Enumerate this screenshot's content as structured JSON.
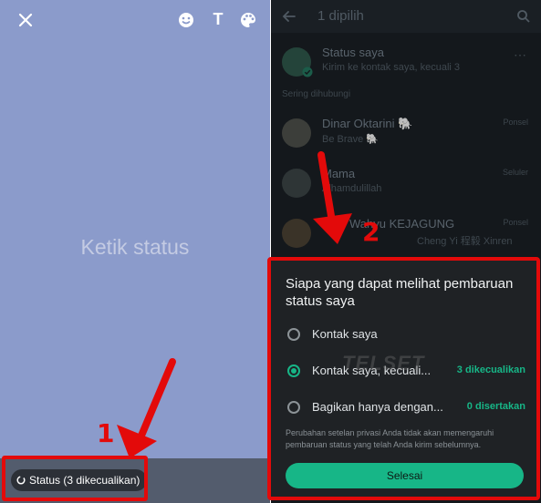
{
  "left": {
    "placeholder": "Ketik status",
    "toolbar_icons": [
      "close-icon",
      "emoji-icon",
      "text-icon",
      "palette-icon"
    ],
    "text_icon_glyph": "T",
    "status_chip": "Status (3 dikecualikan)",
    "background": "#8b9bcb"
  },
  "right": {
    "title": "1 dipilih",
    "my_status": {
      "name": "Status saya",
      "sub": "Kirim ke kontak saya, kecuali 3"
    },
    "section": "Sering dihubungi",
    "contacts": [
      {
        "name": "Dinar Oktarini 🐘",
        "sub": "Be Brave 🐘",
        "meta": "Ponsel"
      },
      {
        "name": "Mama",
        "sub": "Alhamdulillah",
        "meta": "Seluler"
      },
      {
        "name": "Wahyu KEJAGUNG",
        "sub": "Cheng Yi 程毅 Xinren",
        "meta": "Ponsel"
      }
    ]
  },
  "sheet": {
    "title": "Siapa yang dapat melihat pembaruan status saya",
    "options": [
      {
        "label": "Kontak saya",
        "count": "",
        "selected": false
      },
      {
        "label": "Kontak saya, kecuali...",
        "count": "3 dikecualikan",
        "selected": true
      },
      {
        "label": "Bagikan hanya dengan...",
        "count": "0 disertakan",
        "selected": false
      }
    ],
    "note": "Perubahan setelan privasi Anda tidak akan memengaruhi pembaruan status yang telah Anda kirim sebelumnya.",
    "done": "Selesai",
    "watermark": "TELSET",
    "accent": "#17b687"
  },
  "annotations": {
    "num1": "1",
    "num2": "2",
    "color": "#e30a0a"
  }
}
